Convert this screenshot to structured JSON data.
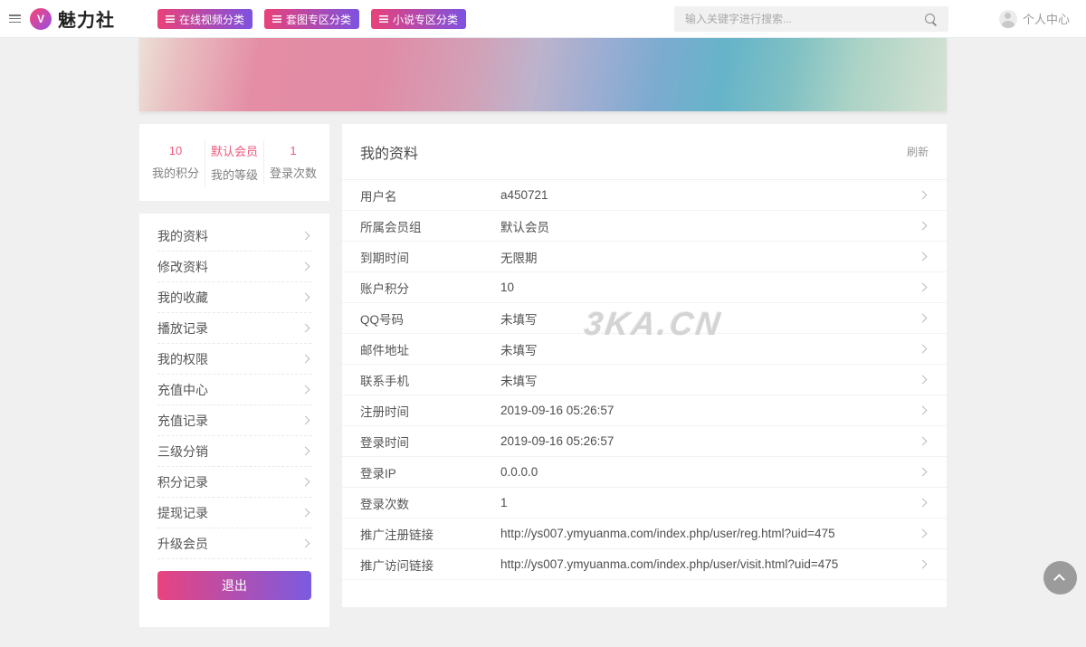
{
  "navbar": {
    "brand": "魅力社",
    "logo_letter": "V",
    "menu_buttons": [
      {
        "label": "在线视频分类"
      },
      {
        "label": "套图专区分类"
      },
      {
        "label": "小说专区分类"
      }
    ],
    "search_placeholder": "输入关键字进行搜索...",
    "user_center_label": "个人中心"
  },
  "sidebar": {
    "stats": [
      {
        "value": "10",
        "label": "我的积分"
      },
      {
        "value": "默认会员",
        "label": "我的等级"
      },
      {
        "value": "1",
        "label": "登录次数"
      }
    ],
    "menu": [
      {
        "label": "我的资料"
      },
      {
        "label": "修改资料"
      },
      {
        "label": "我的收藏"
      },
      {
        "label": "播放记录"
      },
      {
        "label": "我的权限"
      },
      {
        "label": "充值中心"
      },
      {
        "label": "充值记录"
      },
      {
        "label": "三级分销"
      },
      {
        "label": "积分记录"
      },
      {
        "label": "提现记录"
      },
      {
        "label": "升级会员"
      }
    ],
    "logout_label": "退出"
  },
  "profile": {
    "title": "我的资料",
    "refresh_label": "刷新",
    "rows": [
      {
        "label": "用户名",
        "value": "a450721"
      },
      {
        "label": "所属会员组",
        "value": "默认会员"
      },
      {
        "label": "到期时间",
        "value": "无限期"
      },
      {
        "label": "账户积分",
        "value": "10"
      },
      {
        "label": "QQ号码",
        "value": "未填写"
      },
      {
        "label": "邮件地址",
        "value": "未填写"
      },
      {
        "label": "联系手机",
        "value": "未填写"
      },
      {
        "label": "注册时间",
        "value": "2019-09-16 05:26:57"
      },
      {
        "label": "登录时间",
        "value": "2019-09-16 05:26:57"
      },
      {
        "label": "登录IP",
        "value": "0.0.0.0"
      },
      {
        "label": "登录次数",
        "value": "1"
      },
      {
        "label": "推广注册链接",
        "value": "http://ys007.ymyuanma.com/index.php/user/reg.html?uid=475"
      },
      {
        "label": "推广访问链接",
        "value": "http://ys007.ymyuanma.com/index.php/user/visit.html?uid=475"
      }
    ]
  },
  "watermark": "3KA.CN",
  "colors": {
    "accent_pink": "#e94279",
    "accent_purple": "#7d52e0",
    "stat_accent": "#f0587c"
  }
}
